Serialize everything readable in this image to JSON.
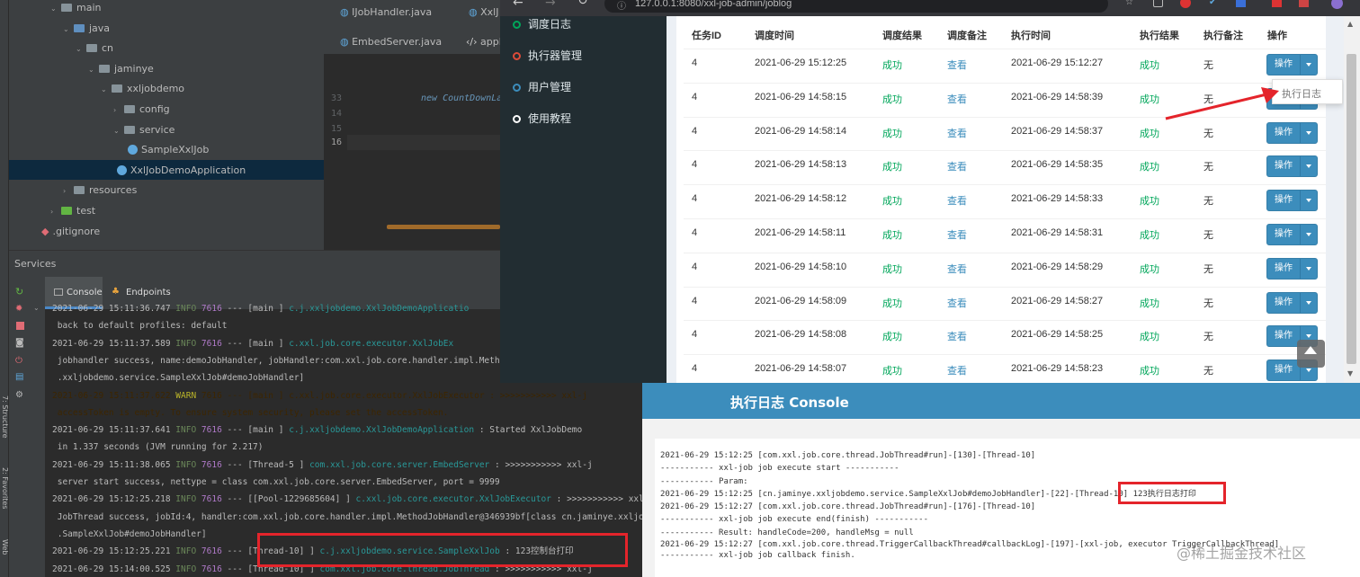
{
  "ide": {
    "tree": [
      {
        "label": "main",
        "kind": "folder",
        "open": true
      },
      {
        "label": "java",
        "kind": "folder-blue",
        "open": true
      },
      {
        "label": "cn",
        "kind": "folder",
        "open": true
      },
      {
        "label": "jaminye",
        "kind": "folder",
        "open": true
      },
      {
        "label": "xxljobdemo",
        "kind": "folder",
        "open": true
      },
      {
        "label": "config",
        "kind": "folder",
        "open": false
      },
      {
        "label": "service",
        "kind": "folder",
        "open": true
      },
      {
        "label": "SampleXxlJob",
        "kind": "class"
      },
      {
        "label": "XxlJobDemoApplication",
        "kind": "class",
        "selected": true
      },
      {
        "label": "resources",
        "kind": "folder",
        "open": false
      },
      {
        "label": "test",
        "kind": "folder-green",
        "open": false
      },
      {
        "label": ".gitignore",
        "kind": "file"
      }
    ],
    "editor_tabs": [
      {
        "label": "IJobHandler.java"
      },
      {
        "label": "XxlJ"
      },
      {
        "label": "EmbedServer.java"
      },
      {
        "label": "appli"
      }
    ],
    "line_numbers": [
      "33",
      "14",
      "15",
      "16"
    ],
    "code_line": "new CountDownLat",
    "services_title": "Services",
    "console_tabs": [
      {
        "label": "Console"
      },
      {
        "label": "Endpoints"
      }
    ],
    "side_labels": {
      "structure": "7: Structure",
      "favorites": "2: Favorites",
      "web": "Web"
    }
  },
  "console": {
    "lines": [
      {
        "ts": "2021-06-29 15:11:36.747",
        "level": "INFO",
        "pid": "7616",
        "thread": "main",
        "logger": "c.j.xxljobdemo.XxlJobDemoApplicatio",
        "msg": ""
      },
      {
        "text": " back to default profiles: default"
      },
      {
        "ts": "2021-06-29 15:11:37.589",
        "level": "INFO",
        "pid": "7616",
        "thread": "main",
        "logger": "c.xxl.job.core.executor.XxlJobEx",
        "msg": ""
      },
      {
        "text": " jobhandler success, name:demoJobHandler, jobHandler:com.xxl.job.core.handler.impl.Method"
      },
      {
        "text": " .xxljobdemo.service.SampleXxlJob#demoJobHandler]"
      },
      {
        "ts": "2021-06-29 15:11:37.622",
        "level": "WARN",
        "pid": "7616",
        "thread": "main",
        "logger": "c.xxl.job.core.executor.XxlJobExecutor",
        "msg": ": >>>>>>>>>>> xxl-j",
        "warn": true
      },
      {
        "text": " accessToken is empty. To ensure system security, please set the accessToken.",
        "warn": true
      },
      {
        "ts": "2021-06-29 15:11:37.641",
        "level": "INFO",
        "pid": "7616",
        "thread": "main",
        "logger": "c.j.xxljobdemo.XxlJobDemoApplication",
        "msg": ": Started XxlJobDemo"
      },
      {
        "text": " in 1.337 seconds (JVM running for 2.217)"
      },
      {
        "ts": "2021-06-29 15:11:38.065",
        "level": "INFO",
        "pid": "7616",
        "thread": "Thread-5",
        "logger": "com.xxl.job.core.server.EmbedServer",
        "msg": ": >>>>>>>>>>> xxl-j"
      },
      {
        "text": " server start success, nettype = class com.xxl.job.core.server.EmbedServer, port = 9999"
      },
      {
        "ts": "2021-06-29 15:12:25.218",
        "level": "INFO",
        "pid": "7616",
        "thread": "[Pool-1229685604]",
        "logger": "c.xxl.job.core.executor.XxlJobExecutor",
        "msg": ": >>>>>>>>>>> xxl-j"
      },
      {
        "text": " JobThread success, jobId:4, handler:com.xxl.job.core.handler.impl.MethodJobHandler@346939bf[class cn.jaminye.xxljobd"
      },
      {
        "text": " .SampleXxlJob#demoJobHandler]"
      },
      {
        "ts": "2021-06-29 15:12:25.221",
        "level": "INFO",
        "pid": "7616",
        "thread": "Thread-10]",
        "logger": "c.j.xxljobdemo.service.SampleXxlJob",
        "msg": ": 123控制台打印"
      },
      {
        "ts": "2021-06-29 15:14:00.525",
        "level": "INFO",
        "pid": "7616",
        "thread": "Thread-10]",
        "logger": "com.xxl.job.core.thread.JobThread",
        "msg": ": >>>>>>>>>>> xxl-j"
      }
    ]
  },
  "browser": {
    "url": "127.0.0.1:8080/xxl-job-admin/joblog"
  },
  "sidebar": {
    "items": [
      {
        "label": "调度日志",
        "color": "#00a65a"
      },
      {
        "label": "执行器管理",
        "color": "#dd4b39"
      },
      {
        "label": "用户管理",
        "color": "#3c8dbc"
      },
      {
        "label": "使用教程",
        "color": "#ffffff"
      }
    ]
  },
  "table": {
    "headers": [
      "任务ID",
      "调度时间",
      "调度结果",
      "调度备注",
      "执行时间",
      "执行结果",
      "执行备注",
      "操作"
    ],
    "rows": [
      {
        "id": "4",
        "trigger_time": "2021-06-29 15:12:25",
        "trigger_result": "成功",
        "trigger_msg": "查看",
        "handle_time": "2021-06-29 15:12:27",
        "handle_result": "成功",
        "handle_msg": "无",
        "op": "操作"
      },
      {
        "id": "4",
        "trigger_time": "2021-06-29 14:58:15",
        "trigger_result": "成功",
        "trigger_msg": "查看",
        "handle_time": "2021-06-29 14:58:39",
        "handle_result": "成功",
        "handle_msg": "无",
        "op": "操作"
      },
      {
        "id": "4",
        "trigger_time": "2021-06-29 14:58:14",
        "trigger_result": "成功",
        "trigger_msg": "查看",
        "handle_time": "2021-06-29 14:58:37",
        "handle_result": "成功",
        "handle_msg": "无",
        "op": "操作"
      },
      {
        "id": "4",
        "trigger_time": "2021-06-29 14:58:13",
        "trigger_result": "成功",
        "trigger_msg": "查看",
        "handle_time": "2021-06-29 14:58:35",
        "handle_result": "成功",
        "handle_msg": "无",
        "op": "操作"
      },
      {
        "id": "4",
        "trigger_time": "2021-06-29 14:58:12",
        "trigger_result": "成功",
        "trigger_msg": "查看",
        "handle_time": "2021-06-29 14:58:33",
        "handle_result": "成功",
        "handle_msg": "无",
        "op": "操作"
      },
      {
        "id": "4",
        "trigger_time": "2021-06-29 14:58:11",
        "trigger_result": "成功",
        "trigger_msg": "查看",
        "handle_time": "2021-06-29 14:58:31",
        "handle_result": "成功",
        "handle_msg": "无",
        "op": "操作"
      },
      {
        "id": "4",
        "trigger_time": "2021-06-29 14:58:10",
        "trigger_result": "成功",
        "trigger_msg": "查看",
        "handle_time": "2021-06-29 14:58:29",
        "handle_result": "成功",
        "handle_msg": "无",
        "op": "操作"
      },
      {
        "id": "4",
        "trigger_time": "2021-06-29 14:58:09",
        "trigger_result": "成功",
        "trigger_msg": "查看",
        "handle_time": "2021-06-29 14:58:27",
        "handle_result": "成功",
        "handle_msg": "无",
        "op": "操作"
      },
      {
        "id": "4",
        "trigger_time": "2021-06-29 14:58:08",
        "trigger_result": "成功",
        "trigger_msg": "查看",
        "handle_time": "2021-06-29 14:58:25",
        "handle_result": "成功",
        "handle_msg": "无",
        "op": "操作"
      },
      {
        "id": "4",
        "trigger_time": "2021-06-29 14:58:07",
        "trigger_result": "成功",
        "trigger_msg": "查看",
        "handle_time": "2021-06-29 14:58:23",
        "handle_result": "成功",
        "handle_msg": "无",
        "op": "操作"
      }
    ],
    "dropdown_item": "执行日志"
  },
  "log_popup": {
    "title": "执行日志 Console",
    "lines": [
      "2021-06-29 15:12:25 [com.xxl.job.core.thread.JobThread#run]-[130]-[Thread-10]",
      "----------- xxl-job job execute start -----------",
      "----------- Param:",
      "2021-06-29 15:12:25 [cn.jaminye.xxljobdemo.service.SampleXxlJob#demoJobHandler]-[22]-[Thread-10] 123执行日志打印",
      "2021-06-29 15:12:27 [com.xxl.job.core.thread.JobThread#run]-[176]-[Thread-10]",
      "----------- xxl-job job execute end(finish) -----------",
      "----------- Result: handleCode=200, handleMsg = null",
      "2021-06-29 15:12:27 [com.xxl.job.core.thread.TriggerCallbackThread#callbackLog]-[197]-[xxl-job, executor TriggerCallbackThread]",
      "----------- xxl-job job callback finish."
    ]
  },
  "watermark": "@稀土掘金技术社区"
}
